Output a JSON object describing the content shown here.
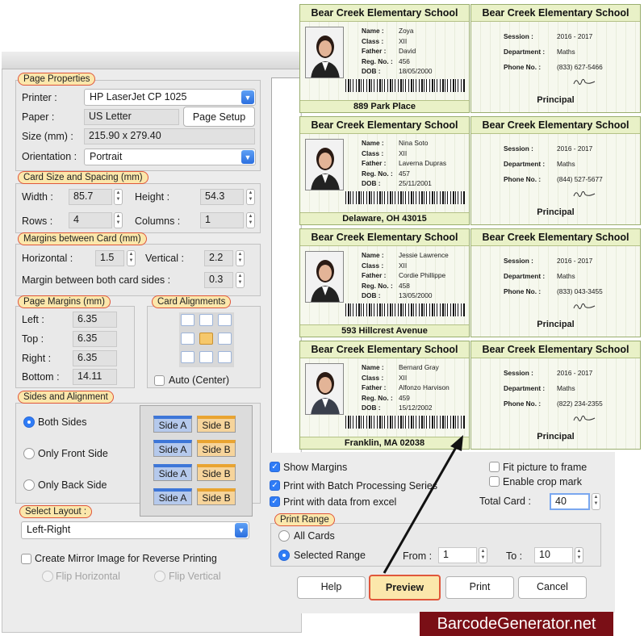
{
  "page_properties": {
    "title": "Page Properties",
    "printer_label": "Printer :",
    "printer_value": "HP LaserJet CP 1025",
    "paper_label": "Paper :",
    "paper_value": "US Letter",
    "page_setup_button": "Page Setup",
    "size_label": "Size (mm) :",
    "size_value": "215.90 x 279.40",
    "orientation_label": "Orientation :",
    "orientation_value": "Portrait"
  },
  "card_size": {
    "title": "Card Size and Spacing (mm)",
    "width_label": "Width :",
    "width_value": "85.7",
    "height_label": "Height :",
    "height_value": "54.3",
    "rows_label": "Rows :",
    "rows_value": "4",
    "columns_label": "Columns :",
    "columns_value": "1"
  },
  "margins_between": {
    "title": "Margins between Card (mm)",
    "horizontal_label": "Horizontal :",
    "horizontal_value": "1.5",
    "vertical_label": "Vertical :",
    "vertical_value": "2.2",
    "both_sides_label": "Margin between both card sides :",
    "both_sides_value": "0.3"
  },
  "page_margins": {
    "title": "Page Margins (mm)",
    "left_label": "Left :",
    "left_value": "6.35",
    "top_label": "Top :",
    "top_value": "6.35",
    "right_label": "Right :",
    "right_value": "6.35",
    "bottom_label": "Bottom :",
    "bottom_value": "14.11"
  },
  "card_alignments": {
    "title": "Card Alignments",
    "auto_center_label": "Auto (Center)"
  },
  "sides": {
    "title": "Sides and Alignment",
    "both_sides": "Both Sides",
    "only_front": "Only Front Side",
    "only_back": "Only Back Side",
    "side_a": "Side A",
    "side_b": "Side B"
  },
  "layout": {
    "title": "Select Layout :",
    "value": "Left-Right",
    "mirror_label": "Create Mirror Image for Reverse Printing",
    "flip_horizontal": "Flip Horizontal",
    "flip_vertical": "Flip Vertical"
  },
  "options": {
    "show_margins": "Show Margins",
    "batch_series": "Print with Batch Processing Series",
    "data_excel": "Print with data from excel",
    "fit_picture": "Fit picture to frame",
    "crop_mark": "Enable crop mark",
    "total_card_label": "Total Card :",
    "total_card_value": "40"
  },
  "print_range": {
    "title": "Print Range",
    "all_cards": "All Cards",
    "selected_range": "Selected Range",
    "from_label": "From :",
    "from_value": "1",
    "to_label": "To :",
    "to_value": "10"
  },
  "buttons": {
    "help": "Help",
    "preview": "Preview",
    "print": "Print",
    "cancel": "Cancel"
  },
  "brand": "BarcodeGenerator.net",
  "cards": [
    {
      "school": "Bear Creek Elementary School",
      "name": "Zoya",
      "class": "XII",
      "father": "David",
      "reg": "456",
      "dob": "18/05/2000",
      "address": "889 Park Place",
      "session": "2016 - 2017",
      "department": "Maths",
      "phone": "(833) 627-5466"
    },
    {
      "school": "Bear Creek Elementary School",
      "name": "Nina Soto",
      "class": "XII",
      "father": "Laverna Dupras",
      "reg": "457",
      "dob": "25/11/2001",
      "address": "Delaware, OH 43015",
      "session": "2016 - 2017",
      "department": "Maths",
      "phone": "(844) 527-5677"
    },
    {
      "school": "Bear Creek Elementary School",
      "name": "Jessie Lawrence",
      "class": "XII",
      "father": "Cordie Phillippe",
      "reg": "458",
      "dob": "13/05/2000",
      "address": "593 Hillcrest Avenue",
      "session": "2016 - 2017",
      "department": "Maths",
      "phone": "(833) 043-3455"
    },
    {
      "school": "Bear Creek Elementary School",
      "name": "Bernard Gray",
      "class": "XII",
      "father": "Alfonzo Harvison",
      "reg": "459",
      "dob": "15/12/2002",
      "address": "Franklin, MA 02038",
      "session": "2016 - 2017",
      "department": "Maths",
      "phone": "(822) 234-2355"
    }
  ],
  "card_labels": {
    "name": "Name :",
    "class": "Class :",
    "father": "Father :",
    "reg": "Reg. No. :",
    "dob": "DOB :",
    "session": "Session :",
    "department": "Department :",
    "phone": "Phone No. :",
    "principal": "Principal"
  }
}
